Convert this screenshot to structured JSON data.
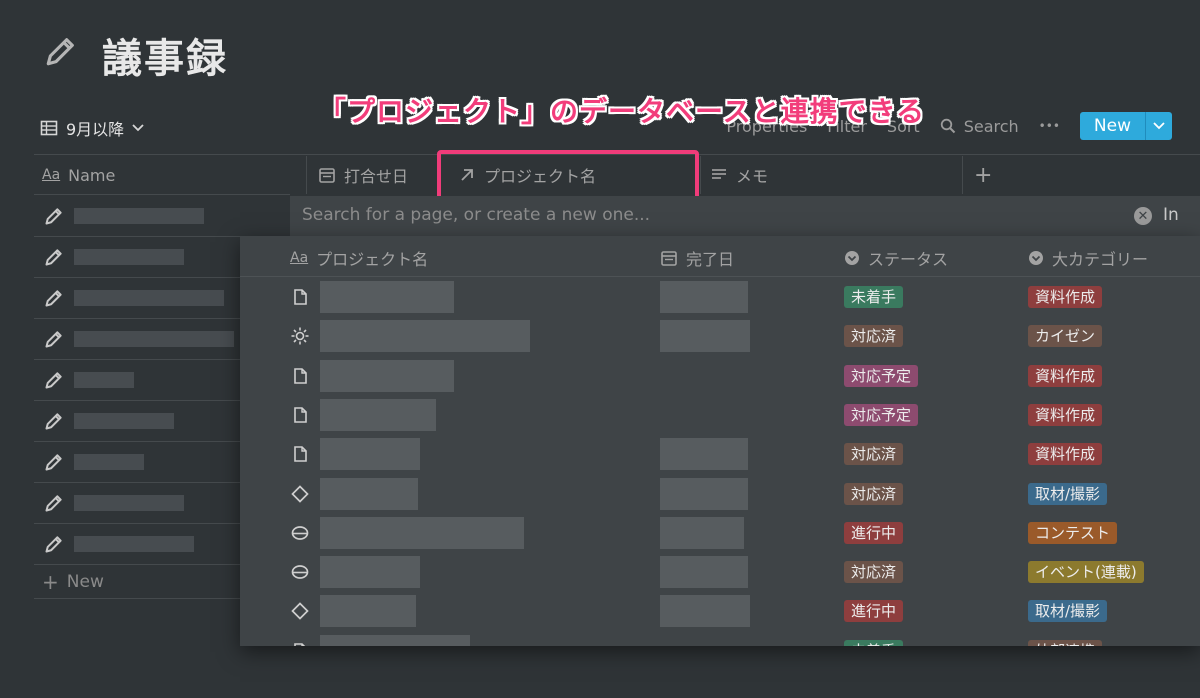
{
  "page": {
    "title": "議事録"
  },
  "view": {
    "name": "9月以降"
  },
  "toolbar": {
    "properties": "Properties",
    "filter": "Filter",
    "sort": "Sort",
    "search": "Search",
    "more": "•••",
    "new": "New"
  },
  "annotation": "「プロジェクト」のデータベースと連携できる",
  "columns": {
    "name": "Name",
    "meeting_date": "打合せ日",
    "project": "プロジェクト名",
    "memo": "メモ",
    "add": "+"
  },
  "new_row": "New",
  "relation_popup": {
    "search_placeholder": "Search for a page, or create a new one...",
    "in_label": "In",
    "headers": {
      "name": "プロジェクト名",
      "done": "完了日",
      "status": "ステータス",
      "category": "大カテゴリー"
    },
    "rows": [
      {
        "icon": "page-icon",
        "status": "未着手",
        "category": "資料作成"
      },
      {
        "icon": "sun-icon",
        "status": "対応済",
        "category": "カイゼン"
      },
      {
        "icon": "page-icon",
        "status": "対応予定",
        "category": "資料作成"
      },
      {
        "icon": "page-icon",
        "status": "対応予定",
        "category": "資料作成"
      },
      {
        "icon": "page-icon",
        "status": "対応済",
        "category": "資料作成"
      },
      {
        "icon": "diamond-icon",
        "status": "対応済",
        "category": "取材/撮影"
      },
      {
        "icon": "stack-icon",
        "status": "進行中",
        "category": "コンテスト"
      },
      {
        "icon": "stack-icon",
        "status": "対応済",
        "category": "イベント(連載)"
      },
      {
        "icon": "diamond-icon",
        "status": "進行中",
        "category": "取材/撮影"
      },
      {
        "icon": "page-icon",
        "status": "未着手",
        "category": "外部連携"
      }
    ]
  },
  "tag_colors": {
    "未着手": "#3a7a5f",
    "対応済": "#6b5349",
    "対応予定": "#8d4b6f",
    "進行中": "#8e3e3e",
    "資料作成": "#8e3e3e",
    "カイゼン": "#6b5349",
    "取材/撮影": "#3b6a8c",
    "コンテスト": "#9a5a2a",
    "イベント(連載)": "#8c7a2e",
    "外部連携": "#6b5349"
  }
}
